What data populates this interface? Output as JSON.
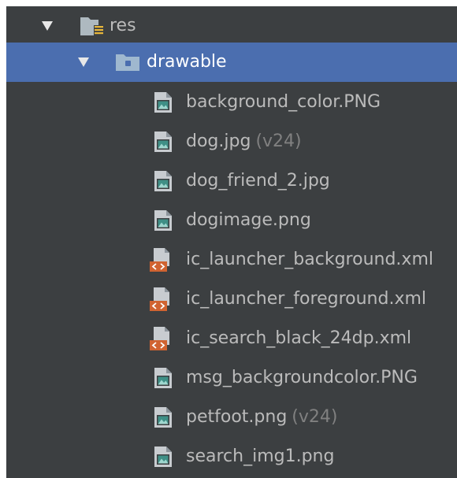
{
  "tree": {
    "res": {
      "label": "res",
      "icon": "resource-folder-icon"
    },
    "drawable": {
      "label": "drawable",
      "icon": "folder-icon"
    },
    "files": [
      {
        "name": "background_color.PNG",
        "suffix": "",
        "icon": "image-file-icon"
      },
      {
        "name": "dog.jpg",
        "suffix": "(v24)",
        "icon": "image-file-icon"
      },
      {
        "name": "dog_friend_2.jpg",
        "suffix": "",
        "icon": "image-file-icon"
      },
      {
        "name": "dogimage.png",
        "suffix": "",
        "icon": "image-file-icon"
      },
      {
        "name": "ic_launcher_background.xml",
        "suffix": "",
        "icon": "xml-file-icon"
      },
      {
        "name": "ic_launcher_foreground.xml",
        "suffix": "",
        "icon": "xml-file-icon"
      },
      {
        "name": "ic_search_black_24dp.xml",
        "suffix": "",
        "icon": "xml-file-icon"
      },
      {
        "name": "msg_backgroundcolor.PNG",
        "suffix": "",
        "icon": "image-file-icon"
      },
      {
        "name": "petfoot.png",
        "suffix": "(v24)",
        "icon": "image-file-icon"
      },
      {
        "name": "search_img1.png",
        "suffix": "",
        "icon": "image-file-icon"
      }
    ]
  },
  "colors": {
    "panel_bg": "#3c3f41",
    "selection": "#4b6eaf",
    "text": "#bbbbbb",
    "muted": "#808080",
    "xml_badge": "#d06331"
  }
}
